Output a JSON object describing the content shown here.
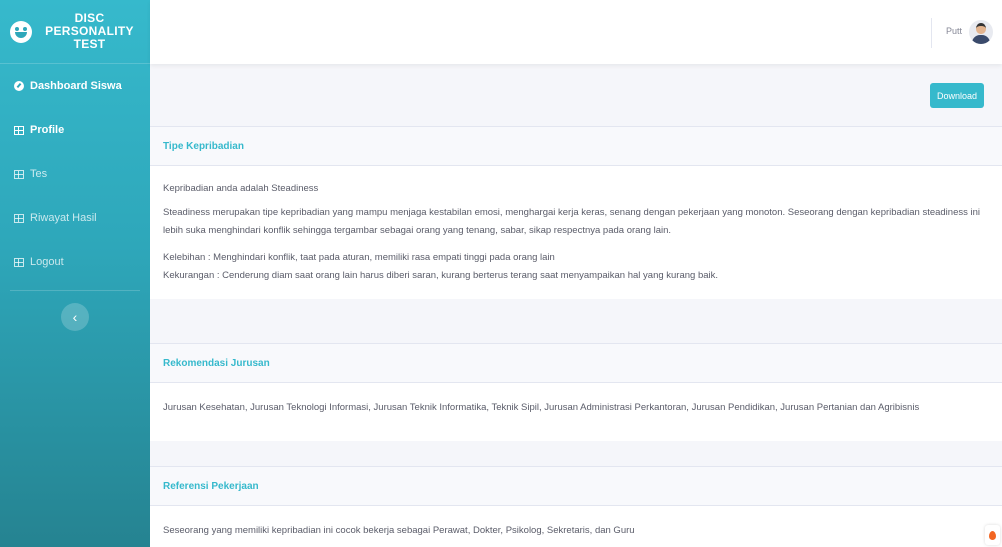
{
  "brand": {
    "line1": "DISC",
    "line2": "PERSONALITY",
    "line3": "TEST"
  },
  "sidebar": {
    "items": [
      {
        "label": "Dashboard Siswa"
      },
      {
        "label": "Profile"
      },
      {
        "label": "Tes"
      },
      {
        "label": "Riwayat Hasil"
      },
      {
        "label": "Logout"
      }
    ],
    "toggle_icon": "chevron-left-icon"
  },
  "topbar": {
    "user_name": "Putt"
  },
  "actions": {
    "download_label": "Download"
  },
  "cards": {
    "tipe": {
      "title": "Tipe Kepribadian",
      "result": "Kepribadian anda adalah Steadiness",
      "description": "Steadiness merupakan tipe kepribadian yang mampu menjaga kestabilan emosi, menghargai kerja keras, senang dengan pekerjaan yang monoton. Seseorang dengan kepribadian steadiness ini lebih suka menghindari konflik sehingga tergambar sebagai orang yang tenang, sabar, sikap respectnya pada orang lain.",
      "kelebihan": "Kelebihan : Menghindari konflik, taat pada aturan, memiliki rasa empati tinggi pada orang lain",
      "kekurangan": "Kekurangan : Cenderung diam saat orang lain harus diberi saran, kurang berterus terang saat menyampaikan hal yang kurang baik."
    },
    "rekomendasi": {
      "title": "Rekomendasi Jurusan",
      "text": "Jurusan Kesehatan, Jurusan Teknologi Informasi, Jurusan Teknik Informatika, Teknik Sipil, Jurusan Administrasi Perkantoran, Jurusan Pendidikan, Jurusan Pertanian dan Agribisnis"
    },
    "referensi": {
      "title": "Referensi Pekerjaan",
      "text": "Seseorang yang memiliki kepribadian ini cocok bekerja sebagai Perawat, Dokter, Psikolog, Sekretaris, dan Guru"
    }
  },
  "colors": {
    "accent": "#36b9cc",
    "sidebar_dark": "#258391"
  }
}
